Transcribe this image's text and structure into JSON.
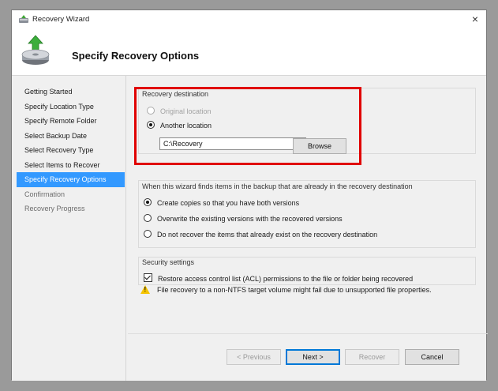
{
  "window": {
    "title": "Recovery Wizard",
    "close_glyph": "×"
  },
  "header": {
    "title": "Specify Recovery Options"
  },
  "nav": {
    "items": [
      {
        "label": "Getting Started",
        "state": "normal"
      },
      {
        "label": "Specify Location Type",
        "state": "normal"
      },
      {
        "label": "Specify Remote Folder",
        "state": "normal"
      },
      {
        "label": "Select Backup Date",
        "state": "normal"
      },
      {
        "label": "Select Recovery Type",
        "state": "normal"
      },
      {
        "label": "Select Items to Recover",
        "state": "normal"
      },
      {
        "label": "Specify Recovery Options",
        "state": "active"
      },
      {
        "label": "Confirmation",
        "state": "disabled"
      },
      {
        "label": "Recovery Progress",
        "state": "disabled"
      }
    ]
  },
  "destination": {
    "group_title": "Recovery destination",
    "original_label": "Original location",
    "another_label": "Another location",
    "path_value": "C:\\Recovery",
    "browse_label": "Browse"
  },
  "conflict": {
    "group_title": "When this wizard finds items in the backup that are already in the recovery destination",
    "options": [
      "Create copies so that you have both versions",
      "Overwrite the existing versions with the recovered versions",
      "Do not recover the items that already exist on the recovery destination"
    ]
  },
  "security": {
    "group_title": "Security settings",
    "acl_label": "Restore access control list (ACL) permissions to the file or folder being recovered"
  },
  "warning": {
    "text": "File recovery to a non-NTFS target volume might fail due to unsupported file properties."
  },
  "footer": {
    "previous_label": "< Previous",
    "next_label": "Next >",
    "recover_label": "Recover",
    "cancel_label": "Cancel"
  },
  "colors": {
    "highlight": "#3399ff",
    "annotation_box": "#e00000"
  }
}
